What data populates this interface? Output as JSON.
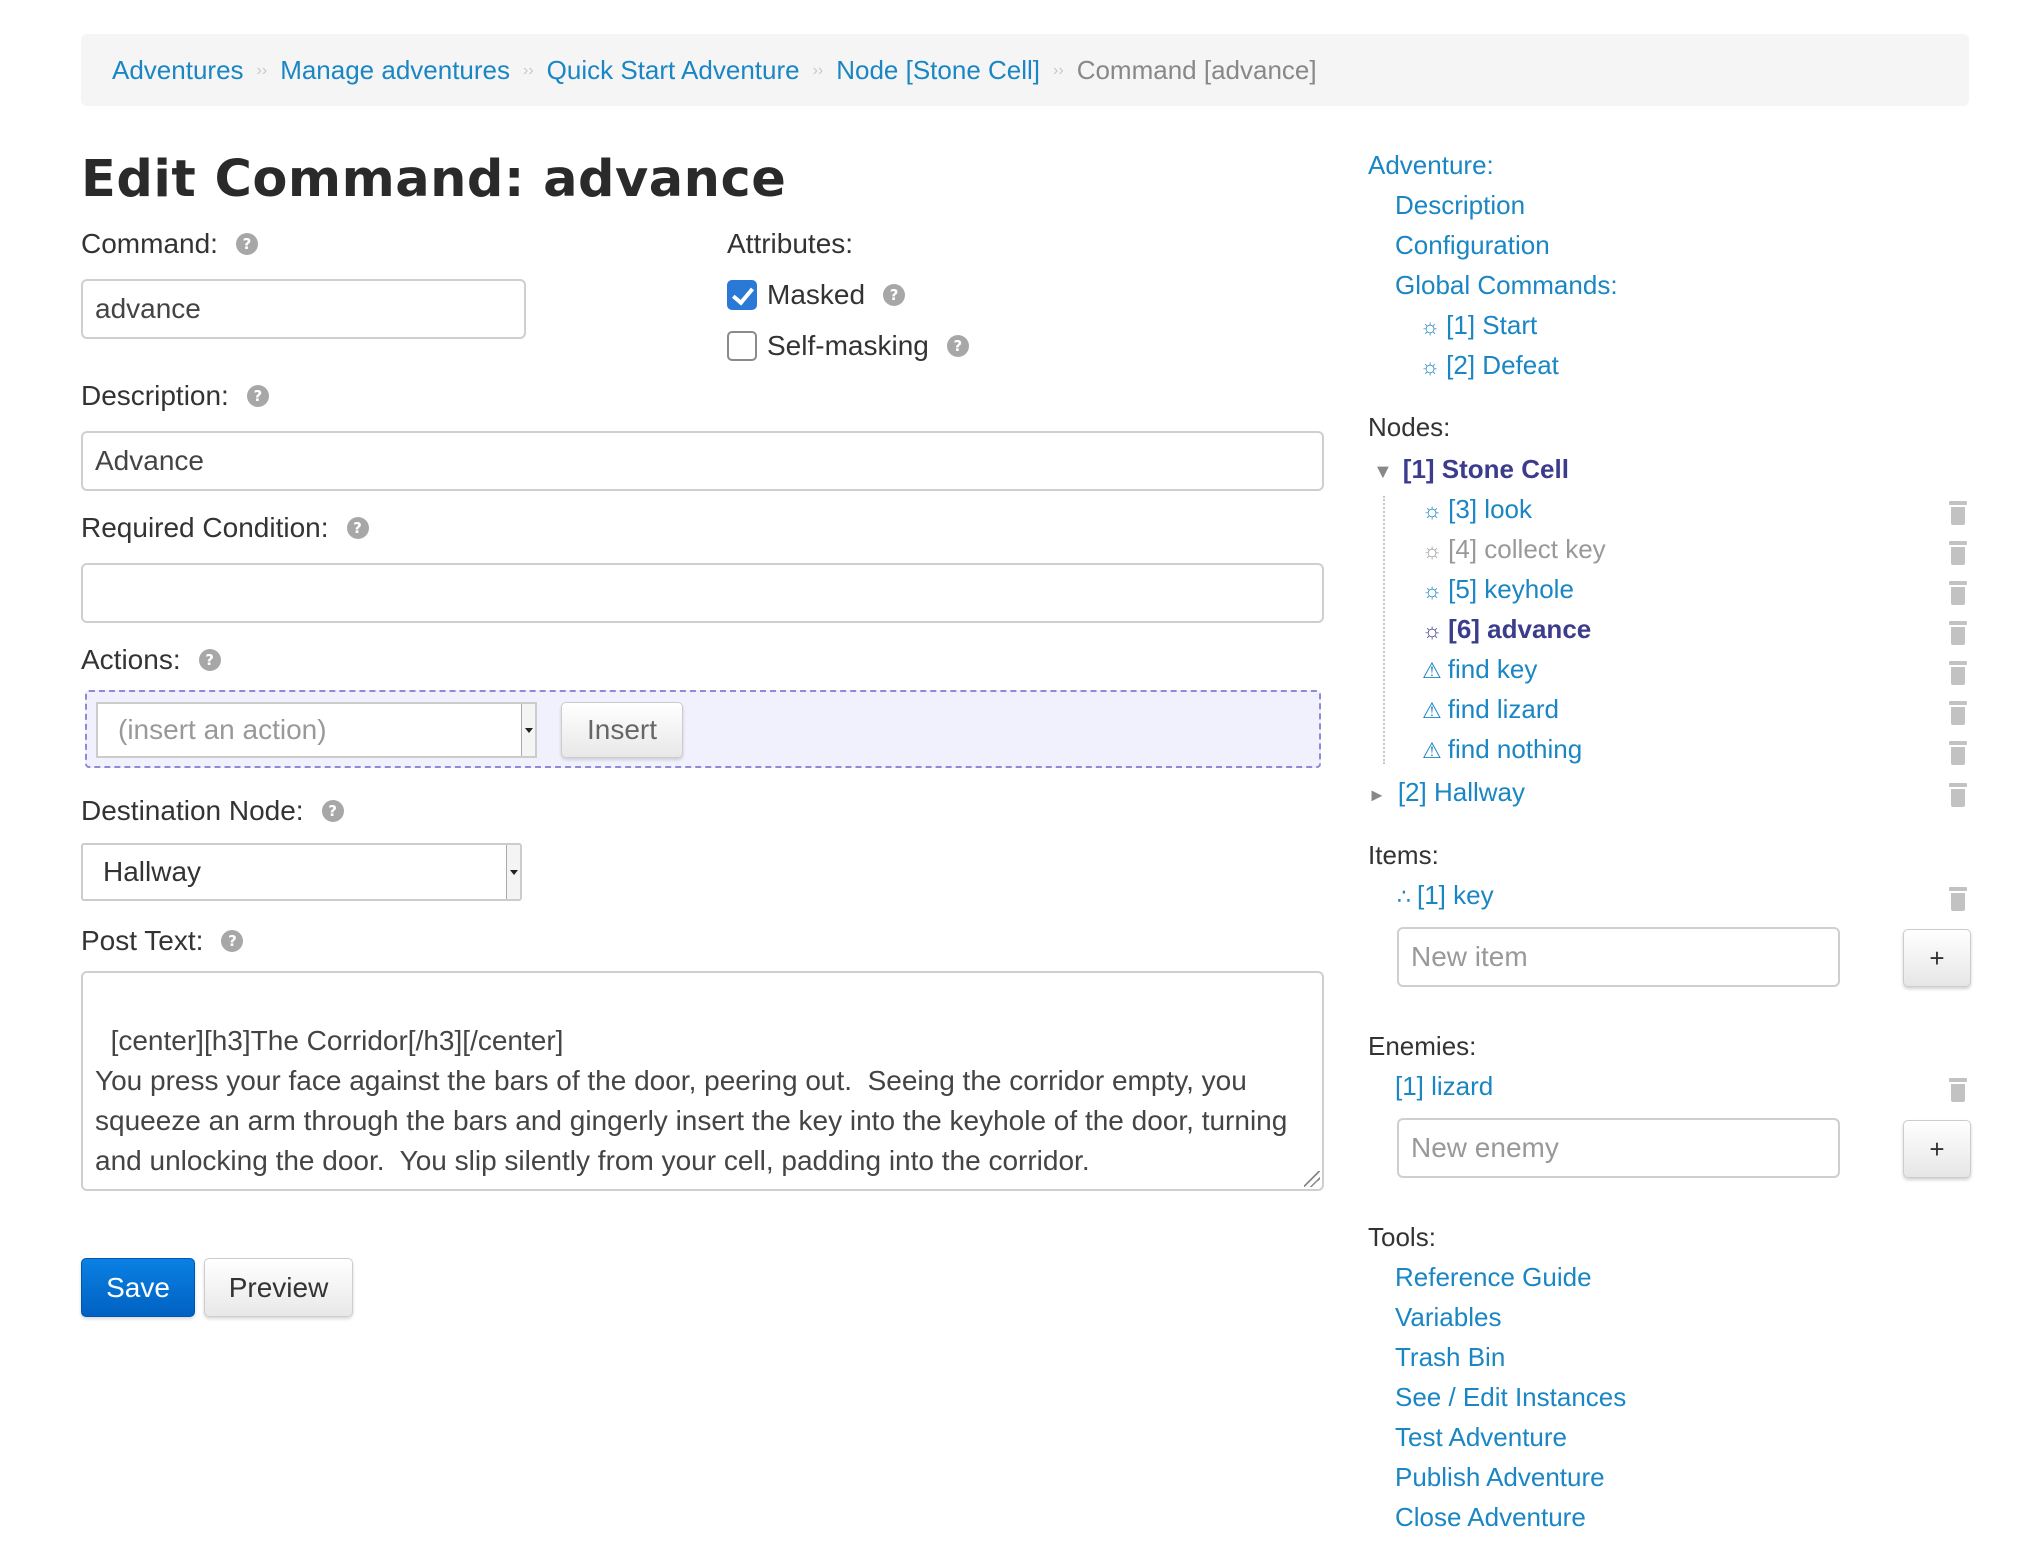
{
  "breadcrumb": {
    "items": [
      "Adventures",
      "Manage adventures",
      "Quick Start Adventure",
      "Node [Stone Cell]"
    ],
    "current": "Command [advance]",
    "separator": "››"
  },
  "page_title": "Edit Command: advance",
  "form": {
    "command": {
      "label": "Command:",
      "value": "advance"
    },
    "attributes": {
      "label": "Attributes:",
      "masked": {
        "label": "Masked",
        "checked": true
      },
      "self_masking": {
        "label": "Self-masking",
        "checked": false
      }
    },
    "description": {
      "label": "Description:",
      "value": "Advance"
    },
    "required_condition": {
      "label": "Required Condition:",
      "value": ""
    },
    "actions": {
      "label": "Actions:",
      "placeholder": "(insert an action)",
      "insert_label": "Insert"
    },
    "destination_node": {
      "label": "Destination Node:",
      "value": "Hallway"
    },
    "post_text": {
      "label": "Post Text:",
      "value": "[center][h3]The Corridor[/h3][/center]\nYou press your face against the bars of the door, peering out.  Seeing the corridor empty, you squeeze an arm through the bars and gingerly insert the key into the keyhole of the door, turning and unlocking the door.  You slip silently from your cell, padding into the corridor."
    },
    "help_glyph": "?",
    "save_label": "Save",
    "preview_label": "Preview"
  },
  "sidebar": {
    "adventure": {
      "heading": "Adventure:",
      "links": [
        "Description",
        "Configuration"
      ],
      "global_commands_heading": "Global Commands:",
      "global_commands": [
        "[1] Start",
        "[2] Defeat"
      ]
    },
    "nodes": {
      "heading": "Nodes:",
      "expanded_node": "[1] Stone Cell",
      "children": [
        {
          "label": "[3] look",
          "type": "command",
          "state": "normal"
        },
        {
          "label": "[4] collect key",
          "type": "command",
          "state": "disabled"
        },
        {
          "label": "[5] keyhole",
          "type": "command",
          "state": "normal"
        },
        {
          "label": "[6] advance",
          "type": "command",
          "state": "active"
        },
        {
          "label": "find key",
          "type": "event",
          "state": "normal"
        },
        {
          "label": "find lizard",
          "type": "event",
          "state": "normal"
        },
        {
          "label": "find nothing",
          "type": "event",
          "state": "normal"
        }
      ],
      "collapsed_node": "[2] Hallway"
    },
    "items": {
      "heading": "Items:",
      "entries": [
        "[1] key"
      ],
      "new_placeholder": "New item",
      "add_label": "+"
    },
    "enemies": {
      "heading": "Enemies:",
      "entries": [
        "[1] lizard"
      ],
      "new_placeholder": "New enemy",
      "add_label": "+"
    },
    "tools": {
      "heading": "Tools:",
      "links": [
        "Reference Guide",
        "Variables",
        "Trash Bin",
        "See / Edit Instances",
        "Test Adventure",
        "Publish Adventure",
        "Close Adventure"
      ]
    },
    "icons": {
      "command": "☼",
      "event": "⚠",
      "item": "∴",
      "expanded": "▼",
      "collapsed": "►"
    }
  },
  "colors": {
    "link": "#1a86c4",
    "active_node": "#3c3c8c",
    "disabled_node": "#999999",
    "primary_button": "#0062c2"
  }
}
